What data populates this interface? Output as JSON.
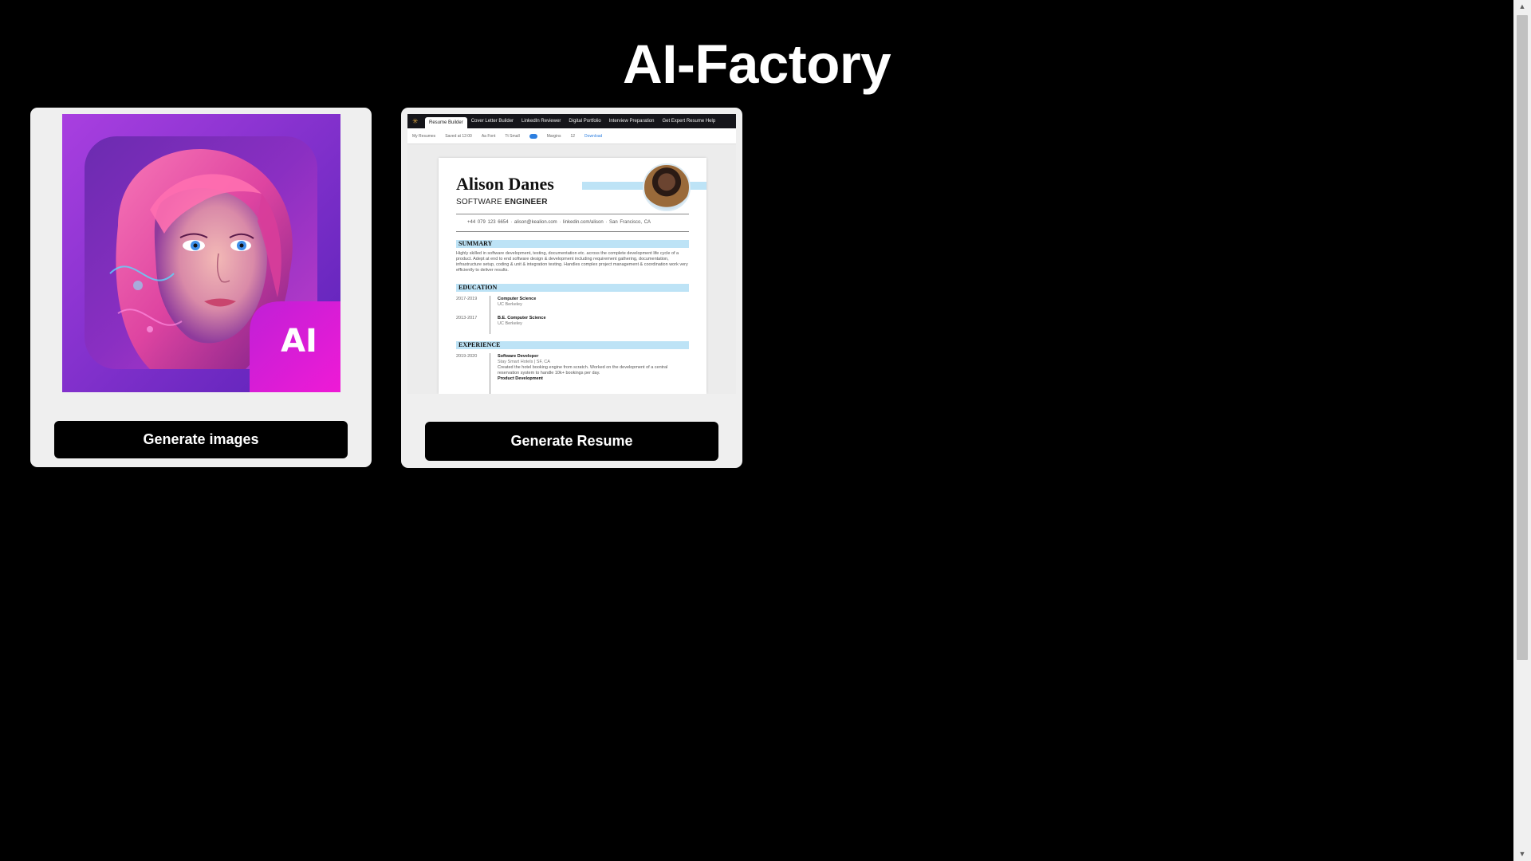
{
  "page": {
    "title": "AI-Factory"
  },
  "cards": [
    {
      "image_alt": "AI portrait app icon",
      "badge": "AI",
      "button_label": "Generate images"
    },
    {
      "image_alt": "Resume builder preview",
      "button_label": "Generate Resume"
    }
  ],
  "resume_preview": {
    "tabs": [
      "Resume Builder",
      "Cover Letter Builder",
      "LinkedIn Reviewer",
      "Digital Portfolio",
      "Interview Preparation",
      "Get Expert Resume Help"
    ],
    "toolbar": [
      "My Resumes",
      "Saved at 12:00",
      "Aa Font",
      "Tt Small",
      "Margins",
      "12",
      "Download"
    ],
    "name": "Alison Danes",
    "role_light": "SOFTWARE",
    "role_bold": "ENGINEER",
    "contact": "+44 079 123 6654  ·  alison@kealion.com  ·  linkedin.com/alison  ·  San Francisco, CA",
    "sections": {
      "summary": "SUMMARY",
      "education": "EDUCATION",
      "experience": "EXPERIENCE"
    },
    "summary_text": "Highly skilled in software development, testing, documentation etc. across the complete development life cycle of a product. Adept at end to end software design & development including requirement gathering, documentation, infrastructure setup, coding & unit & integration testing. Handles complex project management & coordination work very efficiently to deliver results.",
    "education": [
      {
        "years": "2017-2019",
        "degree": "Computer Science",
        "school": "UC Berkeley"
      },
      {
        "years": "2013-2017",
        "degree": "B.E. Computer Science",
        "school": "UC Berkeley"
      }
    ],
    "experience": [
      {
        "years": "2019-2020",
        "title": "Software Developer",
        "company": "Stay Smart Hotels | SF, CA",
        "desc": "Created the hotel booking engine from scratch. Worked on the development of a central reservation system to handle 10k+ bookings per day.",
        "next": "Product Development"
      }
    ]
  },
  "colors": {
    "background": "#000000",
    "card": "#efefef",
    "button": "#000000",
    "accent_pink": "#e11ad8",
    "resume_highlight": "#bde3f6"
  },
  "icons": {
    "scroll_up": "scroll-up-arrow-icon",
    "scroll_down": "scroll-down-arrow-icon"
  }
}
